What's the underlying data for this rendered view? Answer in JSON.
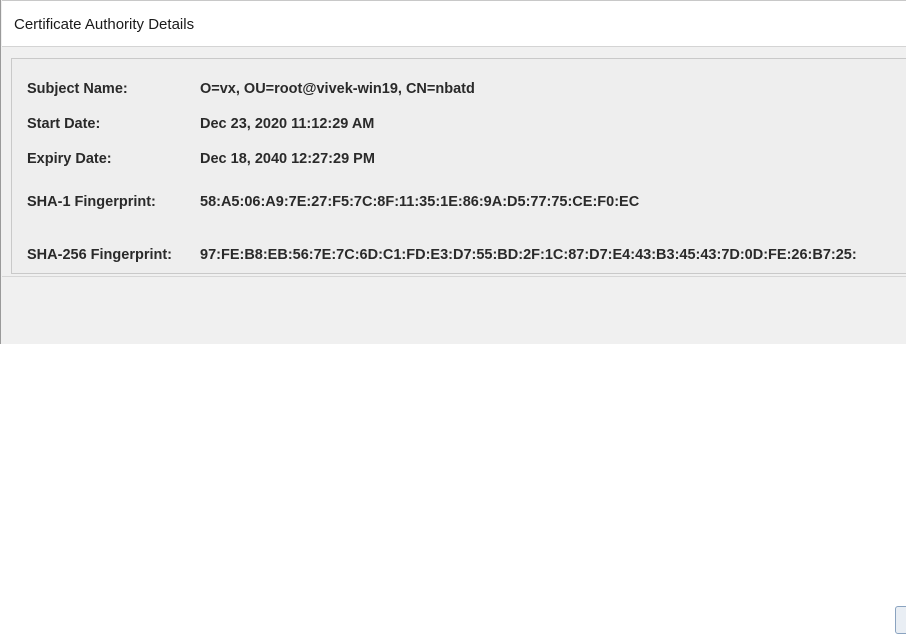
{
  "dialog": {
    "title": "Certificate Authority Details"
  },
  "details": {
    "subject_name": {
      "label": "Subject Name:",
      "value": "O=vx, OU=root@vivek-win19, CN=nbatd"
    },
    "start_date": {
      "label": "Start Date:",
      "value": "Dec 23, 2020 11:12:29 AM"
    },
    "expiry_date": {
      "label": "Expiry Date:",
      "value": "Dec 18, 2040 12:27:29 PM"
    },
    "sha1_fingerprint": {
      "label": "SHA-1 Fingerprint:",
      "value": "58:A5:06:A9:7E:27:F5:7C:8F:11:35:1E:86:9A:D5:77:75:CE:F0:EC"
    },
    "sha256_fingerprint": {
      "label": "SHA-256 Fingerprint:",
      "value": "97:FE:B8:EB:56:7E:7C:6D:C1:FD:E3:D7:55:BD:2F:1C:87:D7:E4:43:B3:45:43:7D:0D:FE:26:B7:25:"
    }
  }
}
